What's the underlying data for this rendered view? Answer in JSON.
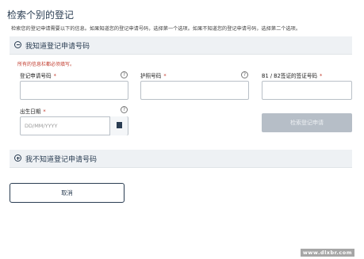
{
  "page": {
    "title": "检索个别的登记",
    "intro": "检索您的登记申请需要以下的信息。如果知道您的登记申请号码，选择第一个选项。如果不知道您的登记申请号码，选择第二个选项。"
  },
  "section_known": {
    "label": "我知道登记申请号码",
    "required_note": "所有的信息栏都必须填写。",
    "fields": {
      "app_number_label": "登记申请号码",
      "passport_label": "护照号码",
      "visa_label": "B1 / B2签证的签证号码",
      "dob_label": "出生日期",
      "dob_placeholder": "DD/MM/YYYY",
      "required_mark": "*",
      "help_glyph": "?"
    },
    "search_label": "检索登记申请"
  },
  "section_unknown": {
    "label": "我不知道登记申请号码"
  },
  "cancel_label": "取消",
  "watermark": "www.dlxbr.com",
  "colors": {
    "heading": "#2a3d52",
    "required": "#c0392b",
    "disabled_button": "#b6bec7",
    "section_bg": "#eef1f4"
  },
  "icons": {
    "expanded": "minus-circle-icon",
    "collapsed": "plus-circle-icon",
    "help": "question-circle-icon",
    "date": "calendar-icon"
  }
}
